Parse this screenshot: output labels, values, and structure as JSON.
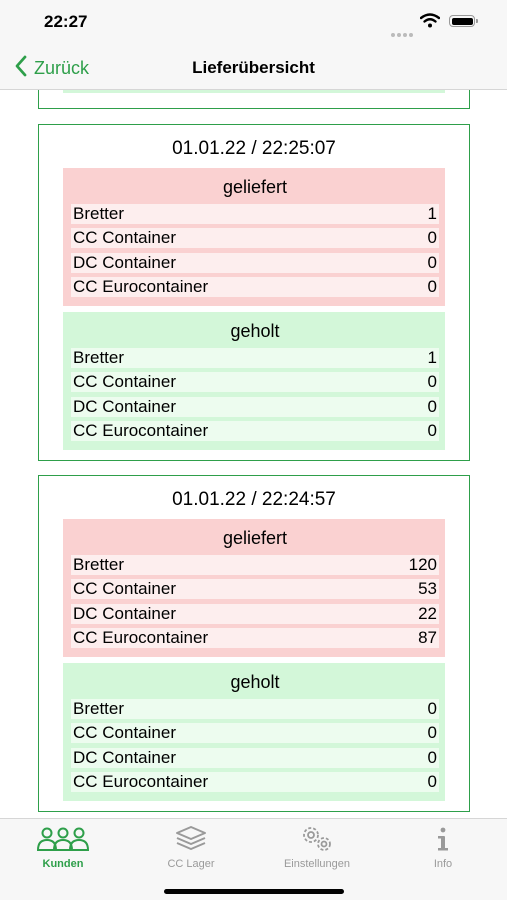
{
  "status": {
    "time": "22:27"
  },
  "nav": {
    "back_label": "Zurück",
    "title": "Lieferübersicht"
  },
  "colors": {
    "accent": "#2e9f4a",
    "delivered_bg": "#fad1d1",
    "fetched_bg": "#d3f7d9"
  },
  "entries": [
    {
      "date": "01.01.22 / 22:25:07",
      "delivered": {
        "title": "geliefert",
        "rows": [
          {
            "label": "Bretter",
            "value": "1"
          },
          {
            "label": "CC Container",
            "value": "0"
          },
          {
            "label": "DC Container",
            "value": "0"
          },
          {
            "label": "CC Eurocontainer",
            "value": "0"
          }
        ]
      },
      "fetched": {
        "title": "geholt",
        "rows": [
          {
            "label": "Bretter",
            "value": "1"
          },
          {
            "label": "CC Container",
            "value": "0"
          },
          {
            "label": "DC Container",
            "value": "0"
          },
          {
            "label": "CC Eurocontainer",
            "value": "0"
          }
        ]
      }
    },
    {
      "date": "01.01.22 / 22:24:57",
      "delivered": {
        "title": "geliefert",
        "rows": [
          {
            "label": "Bretter",
            "value": "120"
          },
          {
            "label": "CC Container",
            "value": "53"
          },
          {
            "label": "DC Container",
            "value": "22"
          },
          {
            "label": "CC Eurocontainer",
            "value": "87"
          }
        ]
      },
      "fetched": {
        "title": "geholt",
        "rows": [
          {
            "label": "Bretter",
            "value": "0"
          },
          {
            "label": "CC Container",
            "value": "0"
          },
          {
            "label": "DC Container",
            "value": "0"
          },
          {
            "label": "CC Eurocontainer",
            "value": "0"
          }
        ]
      }
    }
  ],
  "tabs": [
    {
      "label": "Kunden",
      "icon": "people-icon",
      "active": true
    },
    {
      "label": "CC Lager",
      "icon": "layers-icon",
      "active": false
    },
    {
      "label": "Einstellungen",
      "icon": "gears-icon",
      "active": false
    },
    {
      "label": "Info",
      "icon": "info-icon",
      "active": false
    }
  ]
}
